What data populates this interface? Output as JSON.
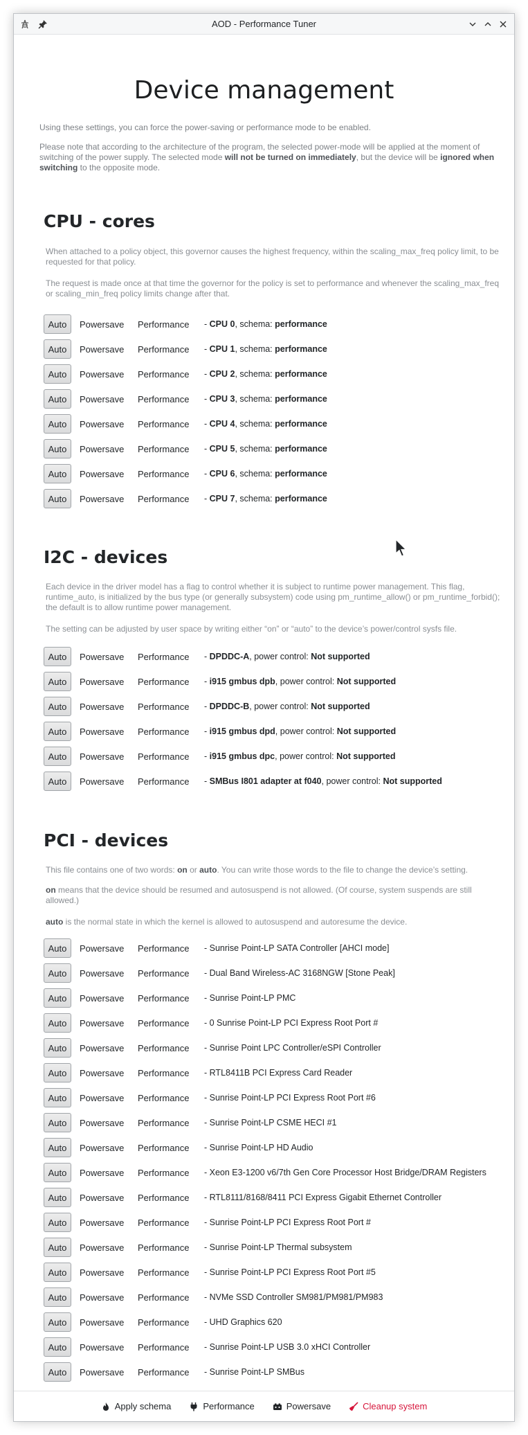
{
  "window": {
    "title": "AOD - Performance Tuner",
    "icons": [
      "app-tower-icon",
      "pin-icon",
      "minimize-icon",
      "maximize-icon",
      "close-icon"
    ]
  },
  "page": {
    "title": "Device management",
    "intro_1": "Using these settings, you can force the power-saving or performance mode to be enabled.",
    "intro_2_a": "Please note that according to the architecture of the program, the selected power-mode will be applied at the moment of switching of the power supply. The selected mode ",
    "intro_2_b": "will not be turned on immediately",
    "intro_2_c": ", but the device will be ",
    "intro_2_d": "ignored when switching",
    "intro_2_e": " to the opposite mode."
  },
  "buttons": {
    "auto": "Auto",
    "powersave": "Powersave",
    "performance": "Performance"
  },
  "cpu": {
    "title": "CPU - cores",
    "desc_1": "When attached to a policy object, this governor causes the highest frequency, within the scaling_max_freq policy limit, to be requested for that policy.",
    "desc_2": "The request is made once at that time the governor for the policy is set to performance and whenever the scaling_max_freq or scaling_min_freq policy limits change after that.",
    "key_label": ", schema: ",
    "items": [
      {
        "name": "CPU 0",
        "value": "performance"
      },
      {
        "name": "CPU 1",
        "value": "performance"
      },
      {
        "name": "CPU 2",
        "value": "performance"
      },
      {
        "name": "CPU 3",
        "value": "performance"
      },
      {
        "name": "CPU 4",
        "value": "performance"
      },
      {
        "name": "CPU 5",
        "value": "performance"
      },
      {
        "name": "CPU 6",
        "value": "performance"
      },
      {
        "name": "CPU 7",
        "value": "performance"
      }
    ]
  },
  "i2c": {
    "title": "I2C - devices",
    "desc_1": "Each device in the driver model has a flag to control whether it is subject to runtime power management. This flag, runtime_auto, is initialized by the bus type (or generally subsystem) code using pm_runtime_allow() or pm_runtime_forbid(); the default is to allow runtime power management.",
    "desc_2": "The setting can be adjusted by user space by writing either “on” or “auto” to the device’s power/control sysfs file.",
    "key_label": ", power control: ",
    "items": [
      {
        "name": "DPDDC-A",
        "value": "Not supported"
      },
      {
        "name": "i915 gmbus dpb",
        "value": "Not supported"
      },
      {
        "name": "DPDDC-B",
        "value": "Not supported"
      },
      {
        "name": "i915 gmbus dpd",
        "value": "Not supported"
      },
      {
        "name": "i915 gmbus dpc",
        "value": "Not supported"
      },
      {
        "name": "SMBus I801 adapter at f040",
        "value": "Not supported"
      }
    ]
  },
  "pci": {
    "title": "PCI - devices",
    "desc_1_a": "This file contains one of two words: ",
    "desc_1_on": "on",
    "desc_1_b": " or ",
    "desc_1_auto": "auto",
    "desc_1_c": ". You can write those words to the file to change the device’s setting.",
    "desc_2_on": "on",
    "desc_2_rest": " means that the device should be resumed and autosuspend is not allowed. (Of course, system suspends are still allowed.)",
    "desc_3_auto": "auto",
    "desc_3_rest": " is the normal state in which the kernel is allowed to autosuspend and autoresume the device.",
    "items": [
      "- Sunrise Point-LP SATA Controller [AHCI mode]",
      "- Dual Band Wireless-AC 3168NGW [Stone Peak]",
      "- Sunrise Point-LP PMC",
      "- 0  Sunrise Point-LP PCI Express Root Port #",
      "- Sunrise Point LPC Controller/eSPI Controller",
      "- RTL8411B PCI Express Card Reader",
      "- Sunrise Point-LP PCI Express Root Port #6",
      "- Sunrise Point-LP CSME HECI #1",
      "- Sunrise Point-LP HD Audio",
      "- Xeon E3-1200 v6/7th Gen Core Processor Host Bridge/DRAM Registers",
      "- RTL8111/8168/8411 PCI Express Gigabit Ethernet Controller",
      "- Sunrise Point-LP PCI Express Root Port #",
      "- Sunrise Point-LP Thermal subsystem",
      "- Sunrise Point-LP PCI Express Root Port #5",
      "- NVMe SSD Controller SM981/PM981/PM983",
      "- UHD Graphics 620",
      "- Sunrise Point-LP USB 3.0 xHCI Controller",
      "- Sunrise Point-LP SMBus"
    ]
  },
  "bottom": {
    "apply": "Apply schema",
    "performance": "Performance",
    "powersave": "Powersave",
    "cleanup": "Cleanup system"
  },
  "colors": {
    "danger": "#d6163b",
    "text": "#232629",
    "muted": "#8a8e93"
  }
}
